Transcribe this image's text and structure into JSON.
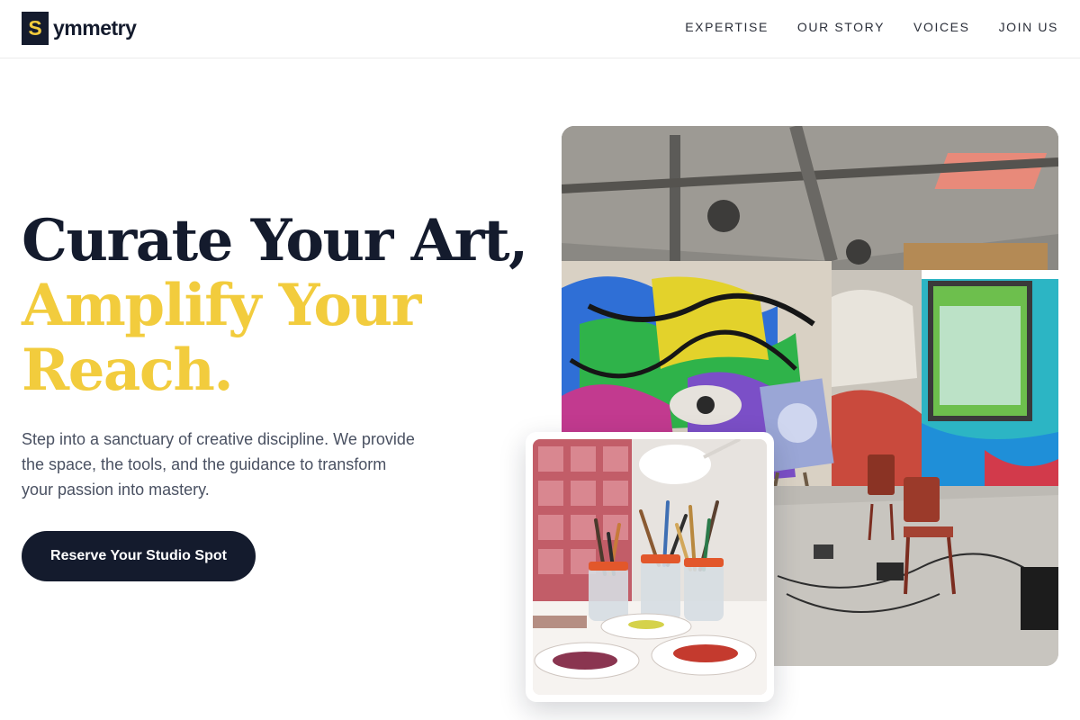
{
  "brand": {
    "mark": "S",
    "name": "ymmetry"
  },
  "nav": {
    "items": [
      {
        "label": "EXPERTISE"
      },
      {
        "label": "OUR STORY"
      },
      {
        "label": "VOICES"
      },
      {
        "label": "JOIN US"
      }
    ]
  },
  "hero": {
    "headline_line1": "Curate Your Art,",
    "headline_line2": "Amplify Your",
    "headline_line3": "Reach.",
    "description": "Step into a sanctuary of creative discipline. We provide the space, the tools, and the guidance to transform your passion into mastery.",
    "cta_label": "Reserve Your Studio Spot"
  },
  "colors": {
    "navy": "#141b2d",
    "gold": "#f2cc3d",
    "muted": "#4a5162"
  },
  "images": {
    "main": "graffiti-art-studio-photo",
    "inset": "paintbrush-jars-photo"
  }
}
